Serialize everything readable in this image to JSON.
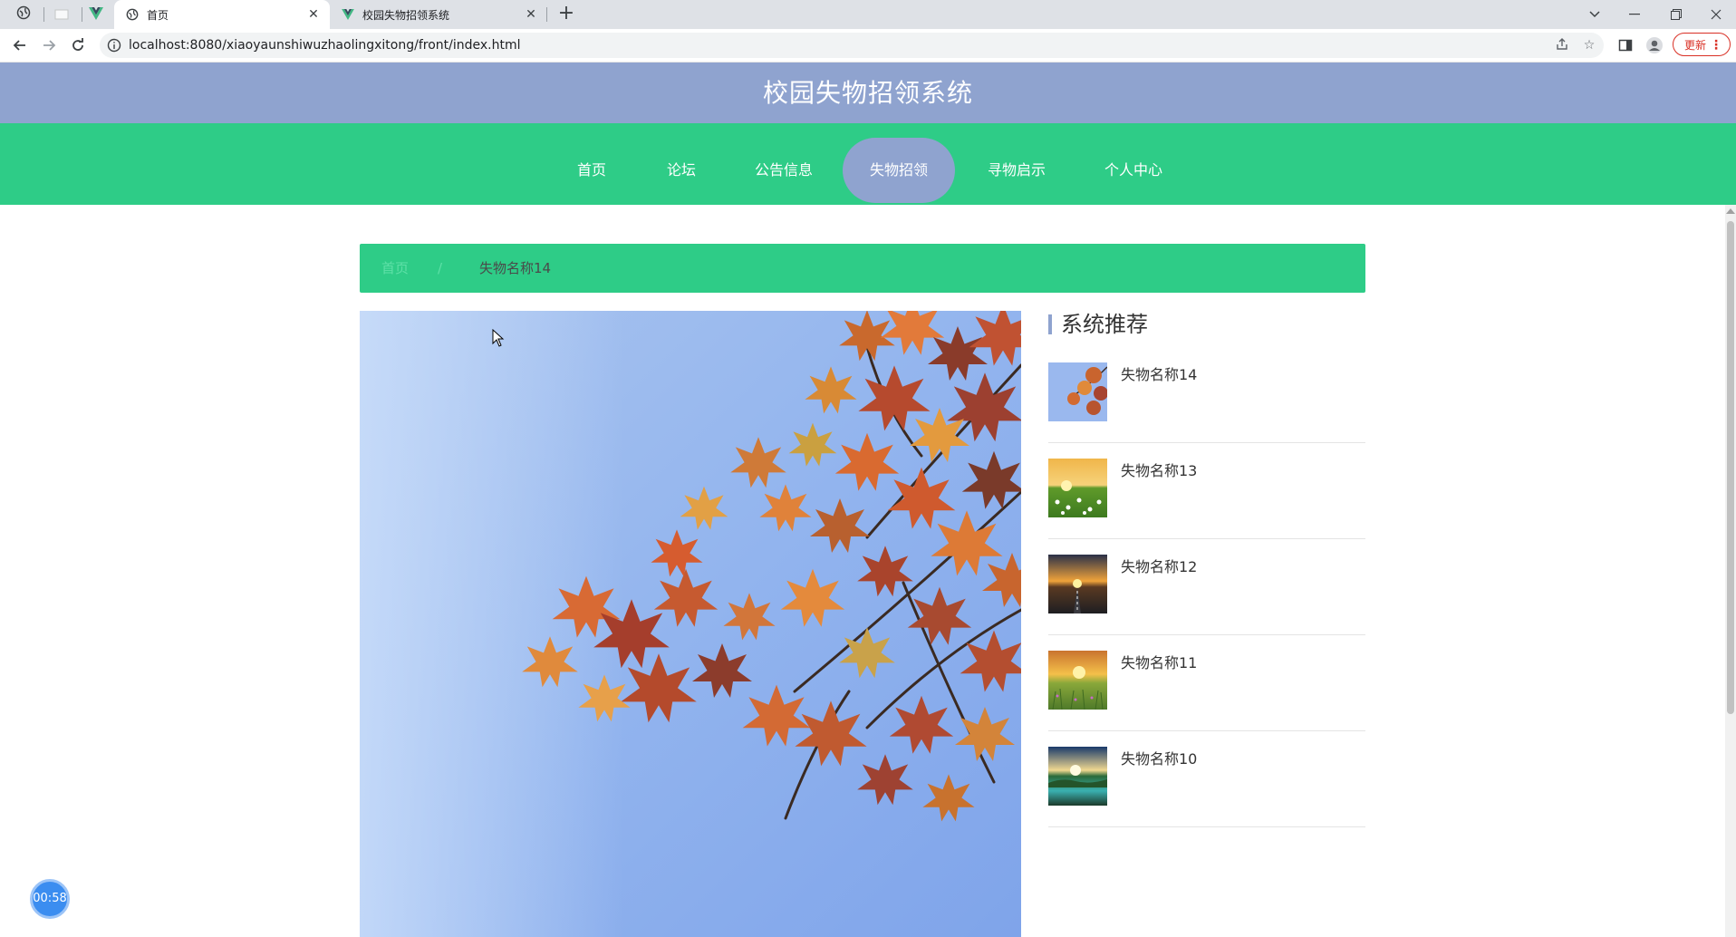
{
  "browser": {
    "tabs": [
      {
        "title": "首页",
        "favicon": "globe-icon",
        "active": true
      },
      {
        "title": "校园失物招领系统",
        "favicon": "vue-icon",
        "active": false
      }
    ],
    "url": "localhost:8080/xiaoyaunshiwuzhaolingxitong/front/index.html",
    "update_label": "更新"
  },
  "site": {
    "title": "校园失物招领系统",
    "header_color": "#8fa3cf",
    "nav_color": "#2ecc87"
  },
  "nav": {
    "items": [
      "首页",
      "论坛",
      "公告信息",
      "失物招领",
      "寻物启示",
      "个人中心"
    ],
    "active": "失物招领"
  },
  "breadcrumb": {
    "home": "首页",
    "separator": "/",
    "current": "失物名称14"
  },
  "sidebar": {
    "title": "系统推荐",
    "items": [
      {
        "name": "失物名称14",
        "thumb": "autumn-leaves"
      },
      {
        "name": "失物名称13",
        "thumb": "flower-field-sunrise"
      },
      {
        "name": "失物名称12",
        "thumb": "road-sunset"
      },
      {
        "name": "失物名称11",
        "thumb": "grass-sunset"
      },
      {
        "name": "失物名称10",
        "thumb": "lake-sunrise"
      }
    ]
  },
  "timer": "00:58"
}
